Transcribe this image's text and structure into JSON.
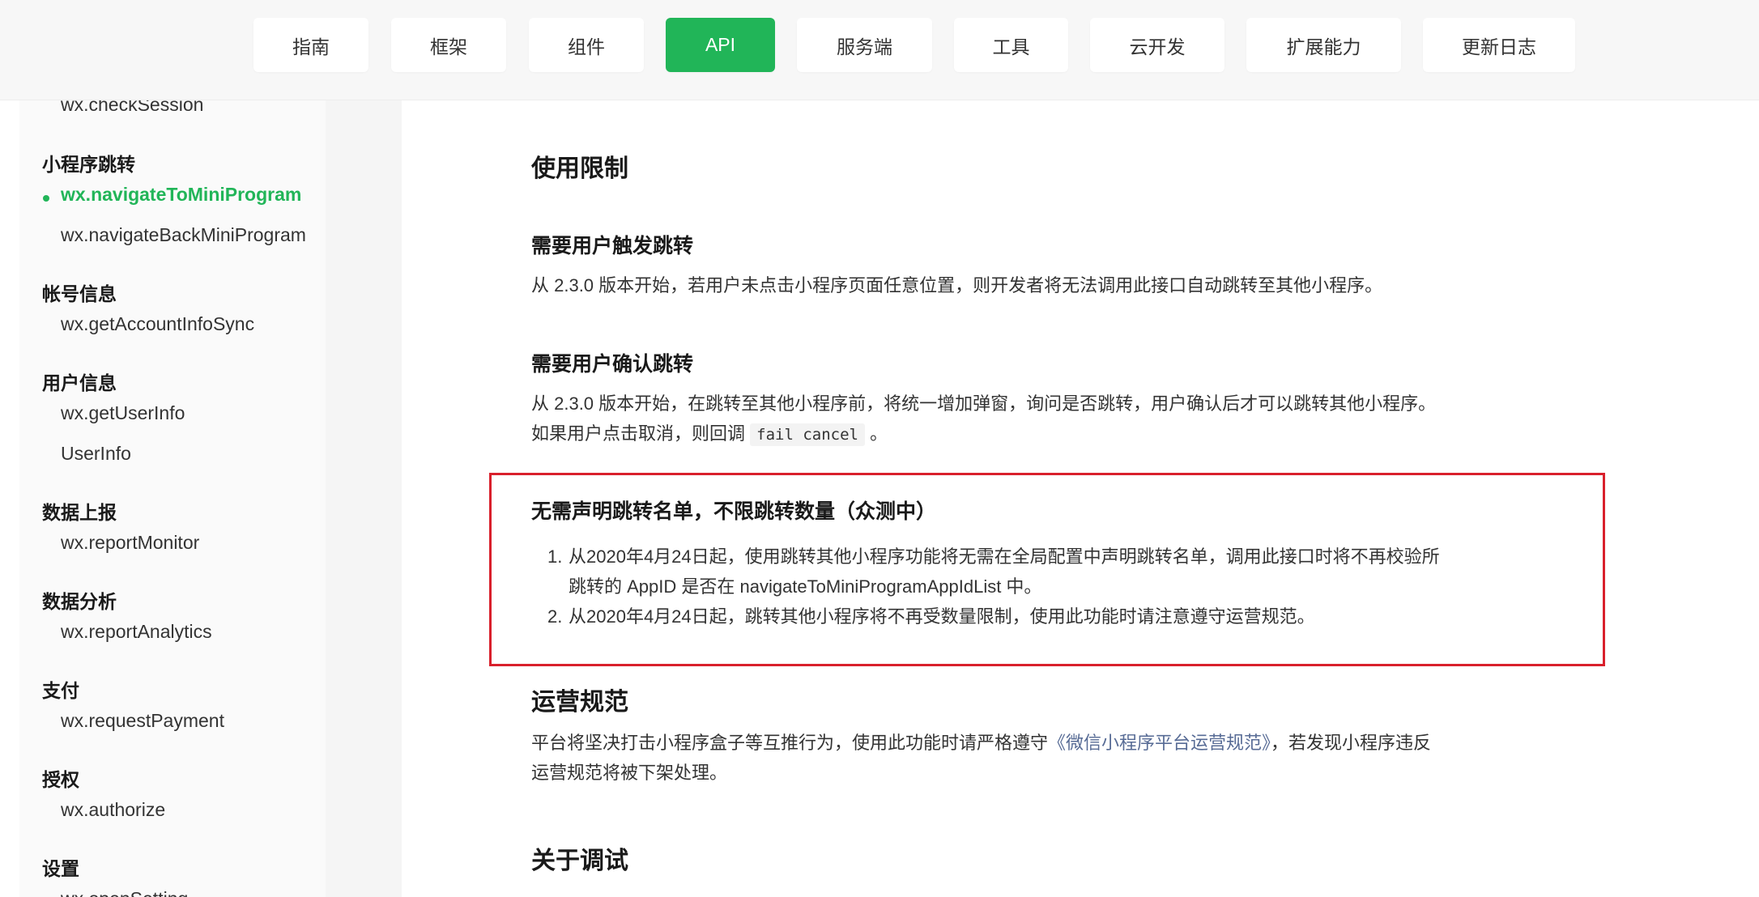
{
  "nav": {
    "tabs": [
      {
        "label": "指南",
        "active": false
      },
      {
        "label": "框架",
        "active": false
      },
      {
        "label": "组件",
        "active": false
      },
      {
        "label": "API",
        "active": true
      },
      {
        "label": "服务端",
        "active": false
      },
      {
        "label": "工具",
        "active": false
      },
      {
        "label": "云开发",
        "active": false
      },
      {
        "label": "扩展能力",
        "active": false
      },
      {
        "label": "更新日志",
        "active": false
      }
    ]
  },
  "sidebar": {
    "check_session": "wx.checkSession",
    "sections": [
      {
        "title": "小程序跳转",
        "items": [
          "wx.navigateToMiniProgram",
          "wx.navigateBackMiniProgram"
        ]
      },
      {
        "title": "帐号信息",
        "items": [
          "wx.getAccountInfoSync"
        ]
      },
      {
        "title": "用户信息",
        "items": [
          "wx.getUserInfo",
          "UserInfo"
        ]
      },
      {
        "title": "数据上报",
        "items": [
          "wx.reportMonitor"
        ]
      },
      {
        "title": "数据分析",
        "items": [
          "wx.reportAnalytics"
        ]
      },
      {
        "title": "支付",
        "items": [
          "wx.requestPayment"
        ]
      },
      {
        "title": "授权",
        "items": [
          "wx.authorize"
        ]
      },
      {
        "title": "设置",
        "items": [
          "wx.openSetting"
        ]
      }
    ],
    "active_item": "wx.navigateToMiniProgram"
  },
  "content": {
    "usage_limits_title": "使用限制",
    "user_trigger": {
      "title": "需要用户触发跳转",
      "text": "从 2.3.0 版本开始，若用户未点击小程序页面任意位置，则开发者将无法调用此接口自动跳转至其他小程序。"
    },
    "user_confirm": {
      "title": "需要用户确认跳转",
      "line1": "从 2.3.0 版本开始，在跳转至其他小程序前，将统一增加弹窗，询问是否跳转，用户确认后才可以跳转其他小程序。",
      "line2_prefix": "如果用户点击取消，则回调",
      "line2_code": "fail cancel",
      "line2_suffix": "。"
    },
    "no_whitelist": {
      "title": "无需声明跳转名单，不限跳转数量（众测中）",
      "items": [
        {
          "num": "1.",
          "line1": "从2020年4月24日起，使用跳转其他小程序功能将无需在全局配置中声明跳转名单，调用此接口时将不再校验所",
          "line2": "跳转的 AppID 是否在 navigateToMiniProgramAppIdList 中。"
        },
        {
          "num": "2.",
          "line1": "从2020年4月24日起，跳转其他小程序将不再受数量限制，使用此功能时请注意遵守运营规范。"
        }
      ]
    },
    "operation_rules": {
      "title": "运营规范",
      "line1_prefix": "平台将坚决打击小程序盒子等互推行为，使用此功能时请严格遵守",
      "line1_link": "《微信小程序平台运营规范》",
      "line1_suffix": "，若发现小程序违反",
      "line2": "运营规范将被下架处理。"
    },
    "debug_title": "关于调试"
  },
  "colors": {
    "accent": "#21b558",
    "highlight_border": "#d9202c",
    "link": "#576b95"
  }
}
